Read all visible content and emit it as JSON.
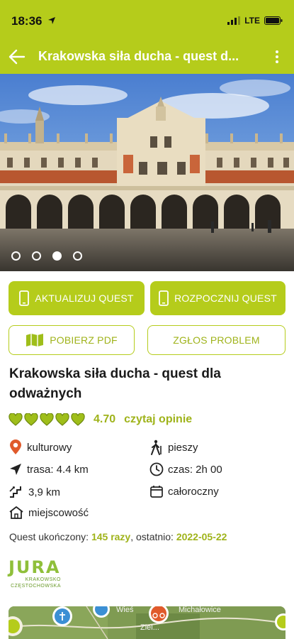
{
  "status_bar": {
    "time": "18:36",
    "network": "LTE"
  },
  "app_bar": {
    "title": "Krakowska siła ducha - quest d..."
  },
  "gallery": {
    "slides": 4,
    "active_index": 2
  },
  "actions": {
    "update_quest": "AKTUALIZUJ QUEST",
    "start_quest": "ROZPOCZNIJ QUEST",
    "download_pdf": "POBIERZ PDF",
    "report_problem": "ZGŁOS PROBLEM"
  },
  "quest": {
    "title": "Krakowska siła ducha - quest dla odważnych",
    "rating": "4.70",
    "rating_fraction": 0.94,
    "reviews_link": "czytaj opinie",
    "category": "kulturowy",
    "mode": "pieszy",
    "route": "trasa: 4.4 km",
    "duration": "czas: 2h 00",
    "elevation": "3,9 km",
    "season": "całoroczny",
    "place_type": "miejscowość"
  },
  "completion": {
    "prefix": "Quest ukończony:",
    "count": "145 razy",
    "middle": ", ostatnio:",
    "last_date": "2022-05-22"
  },
  "logo": {
    "main": "JURA",
    "line1": "KRAKOWSKO",
    "line2": "CZĘSTOCHOWSKA"
  },
  "map": {
    "labels": [
      "Wieś",
      "Michałowice",
      "Ziel..."
    ]
  },
  "colors": {
    "accent": "#b5cc1b",
    "accent_text": "#9fb31a",
    "heart": "#9fbe1a",
    "pin": "#e05a2b"
  },
  "icons": [
    "back-arrow-icon",
    "more-icon",
    "phone-icon",
    "map-icon",
    "heart-icon",
    "location-pin-icon",
    "hiker-icon",
    "navigation-icon",
    "clock-icon",
    "elevation-icon",
    "calendar-icon",
    "home-icon"
  ]
}
